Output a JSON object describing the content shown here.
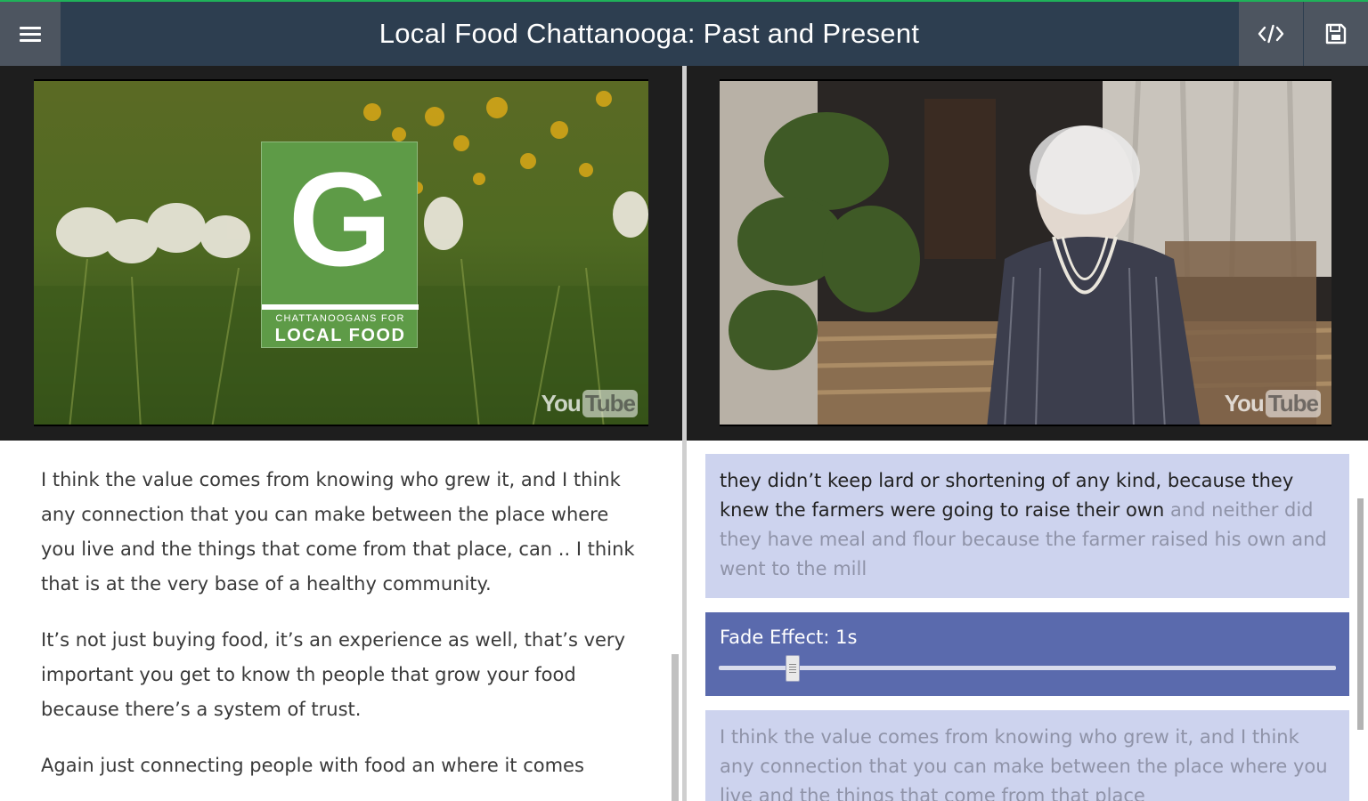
{
  "header": {
    "title": "Local Food Chattanooga: Past and Present"
  },
  "icons": {
    "menu": "hamburger-menu-icon",
    "embed": "code-icon",
    "save": "floppy-disk-icon"
  },
  "videos": {
    "left": {
      "logo_letter": "G",
      "logo_line1": "CHATTANOOGANS FOR",
      "logo_line2": "LOCAL FOOD",
      "watermark_you": "You",
      "watermark_tube": "Tube"
    },
    "right": {
      "watermark_you": "You",
      "watermark_tube": "Tube"
    }
  },
  "left_transcript": {
    "paragraphs": [
      "I think the value comes from knowing who grew it, and I think any connection that you can make between the place where you live and the things that come from that place, can .. I think that is at the very base of a healthy community.",
      "It’s not just buying food, it’s an experience as well, that’s very important you get to know th people that grow your food because there’s a system of trust.",
      "Again just connecting people with food an where it comes"
    ]
  },
  "right_transcript": {
    "quote1_active": "they didn’t keep lard or shortening of any kind, because they knew the farmers were going to raise their own",
    "quote1_faded": "and neither did they have meal and flour because the farmer raised his own and went to the mill",
    "fade_label": "Fade Effect: 1s",
    "fade_value_fraction": 0.12,
    "quote2": "I think the value comes from knowing who grew it, and I think any connection that you can make between the place where you live and the things that come from that place"
  },
  "colors": {
    "header_bg": "#2d3e50",
    "header_accent": "#1fb25a",
    "card_bg": "#cdd3ee",
    "fade_card_bg": "#5a6aad"
  }
}
